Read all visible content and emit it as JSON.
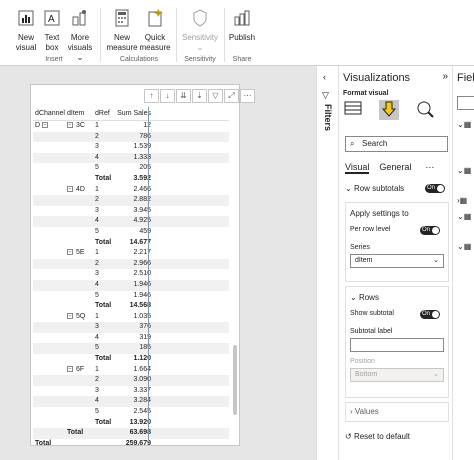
{
  "ribbon": {
    "buttons": [
      {
        "label1": "New",
        "label2": "visual"
      },
      {
        "label1": "Text",
        "label2": "box"
      },
      {
        "label1": "More",
        "label2": "visuals"
      },
      {
        "label1": "New",
        "label2": "measure"
      },
      {
        "label1": "Quick",
        "label2": "measure"
      },
      {
        "label1": "Sensitivity",
        "label2": ""
      },
      {
        "label1": "Publish",
        "label2": ""
      }
    ],
    "groups": [
      "Insert",
      "Calculations",
      "Sensitivity",
      "Share"
    ]
  },
  "matrix": {
    "headers": [
      "dChannel",
      "dItem",
      "dRef",
      "Sum Sales"
    ],
    "rows": [
      [
        "D",
        "3C",
        "1",
        "12"
      ],
      [
        "",
        "",
        "2",
        "786"
      ],
      [
        "",
        "",
        "3",
        "1.539"
      ],
      [
        "",
        "",
        "4",
        "1.333"
      ],
      [
        "",
        "",
        "5",
        "205"
      ],
      [
        "",
        "",
        "Total",
        "3.592"
      ],
      [
        "",
        "4D",
        "1",
        "2.466"
      ],
      [
        "",
        "",
        "2",
        "2.882"
      ],
      [
        "",
        "",
        "3",
        "3.945"
      ],
      [
        "",
        "",
        "4",
        "4.925"
      ],
      [
        "",
        "",
        "5",
        "459"
      ],
      [
        "",
        "",
        "Total",
        "14.677"
      ],
      [
        "",
        "5E",
        "1",
        "2.217"
      ],
      [
        "",
        "",
        "2",
        "2.966"
      ],
      [
        "",
        "",
        "3",
        "2.510"
      ],
      [
        "",
        "",
        "4",
        "1.946"
      ],
      [
        "",
        "",
        "5",
        "1.946"
      ],
      [
        "",
        "",
        "Total",
        "14.568"
      ],
      [
        "",
        "5Q",
        "1",
        "1.035"
      ],
      [
        "",
        "",
        "3",
        "376"
      ],
      [
        "",
        "",
        "4",
        "319"
      ],
      [
        "",
        "",
        "5",
        "185"
      ],
      [
        "",
        "",
        "Total",
        "1.120"
      ],
      [
        "",
        "6F",
        "1",
        "1.664"
      ],
      [
        "",
        "",
        "2",
        "3.090"
      ],
      [
        "",
        "",
        "3",
        "3.337"
      ],
      [
        "",
        "",
        "4",
        "3.284"
      ],
      [
        "",
        "",
        "5",
        "2.545"
      ],
      [
        "",
        "",
        "Total",
        "13.920"
      ],
      [
        "",
        "Total",
        "",
        "63.698"
      ],
      [
        "Total",
        "",
        "",
        "259.679"
      ]
    ]
  },
  "filters": {
    "label": "Filters"
  },
  "viz": {
    "title": "Visualizations",
    "format_visual": "Format visual",
    "search_placeholder": "Search",
    "tab_visual": "Visual",
    "tab_general": "General",
    "row_subtotals": "Row subtotals",
    "row_subtotals_toggle": "On",
    "apply_settings_to": "Apply settings to",
    "per_row_level": "Per row level",
    "per_row_level_toggle": "On",
    "series_label": "Series",
    "series_value": "dItem",
    "rows_section": "Rows",
    "show_subtotal": "Show subtotal",
    "show_subtotal_toggle": "On",
    "subtotal_label": "Subtotal label",
    "subtotal_label_value": "",
    "position_label": "Position",
    "position_value": "Bottom",
    "values_section": "Values",
    "reset": "Reset to default"
  },
  "fields": {
    "title": "Fiel"
  }
}
